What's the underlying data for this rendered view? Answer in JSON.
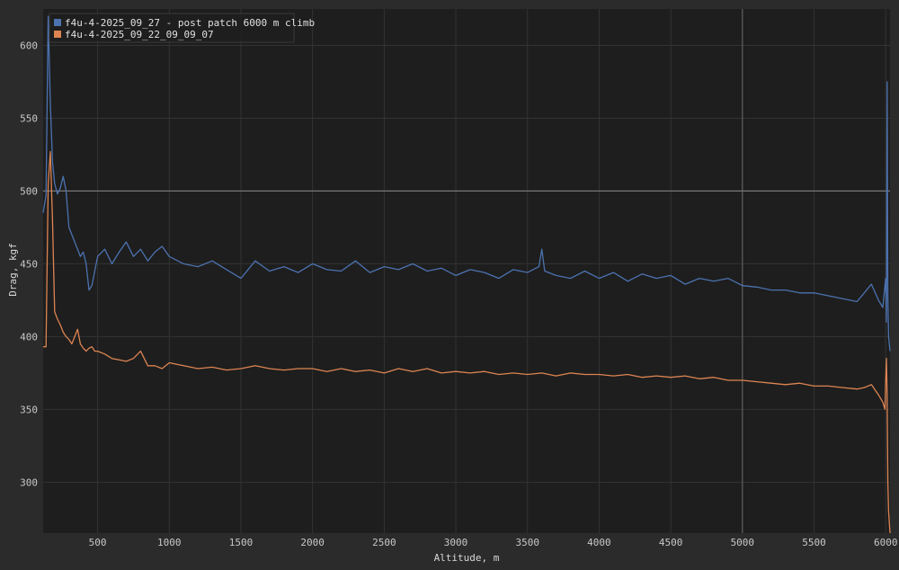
{
  "chart_data": {
    "type": "line",
    "xlabel": "Altitude, m",
    "ylabel": "Drag, kgf",
    "xlim": [
      120,
      6030
    ],
    "ylim": [
      265,
      625
    ],
    "xticks": [
      500,
      1000,
      1500,
      2000,
      2500,
      3000,
      3500,
      4000,
      4500,
      5000,
      5500,
      6000
    ],
    "yticks": [
      300,
      350,
      400,
      450,
      500,
      550,
      600
    ],
    "grid": true,
    "legend_position": "top-left",
    "reference_lines": {
      "horizontal_at_y": 500,
      "vertical_at_x": 5000
    },
    "series": [
      {
        "name": "f4u-4-2025_09_27 - post patch 6000 m climb",
        "color": "#4c72b0",
        "x": [
          120,
          140,
          155,
          170,
          185,
          200,
          220,
          240,
          260,
          280,
          300,
          320,
          340,
          360,
          380,
          400,
          420,
          440,
          460,
          480,
          500,
          550,
          600,
          650,
          700,
          750,
          800,
          850,
          900,
          950,
          1000,
          1100,
          1200,
          1300,
          1400,
          1500,
          1600,
          1700,
          1800,
          1900,
          2000,
          2100,
          2200,
          2300,
          2400,
          2500,
          2600,
          2700,
          2800,
          2900,
          3000,
          3100,
          3200,
          3300,
          3400,
          3500,
          3580,
          3600,
          3620,
          3700,
          3800,
          3900,
          4000,
          4100,
          4200,
          4300,
          4400,
          4500,
          4600,
          4700,
          4800,
          4900,
          5000,
          5100,
          5200,
          5300,
          5400,
          5500,
          5600,
          5700,
          5800,
          5850,
          5900,
          5950,
          5980,
          6000,
          6005,
          6010,
          6015,
          6020,
          6030
        ],
        "y": [
          485,
          497,
          620,
          560,
          520,
          505,
          498,
          502,
          510,
          500,
          475,
          470,
          465,
          460,
          455,
          458,
          450,
          432,
          435,
          445,
          455,
          460,
          450,
          458,
          465,
          455,
          460,
          452,
          458,
          462,
          455,
          450,
          448,
          452,
          446,
          440,
          452,
          445,
          448,
          444,
          450,
          446,
          445,
          452,
          444,
          448,
          446,
          450,
          445,
          447,
          442,
          446,
          444,
          440,
          446,
          444,
          448,
          460,
          445,
          442,
          440,
          445,
          440,
          444,
          438,
          443,
          440,
          442,
          436,
          440,
          438,
          440,
          435,
          434,
          432,
          432,
          430,
          430,
          428,
          426,
          424,
          430,
          436,
          425,
          420,
          440,
          410,
          575,
          430,
          400,
          390
        ]
      },
      {
        "name": "f4u-4-2025_09_22_09_09_07",
        "color": "#dd8452",
        "x": [
          120,
          140,
          155,
          170,
          185,
          200,
          220,
          240,
          260,
          280,
          300,
          320,
          340,
          360,
          380,
          400,
          420,
          440,
          460,
          480,
          500,
          550,
          600,
          650,
          700,
          750,
          800,
          850,
          900,
          950,
          1000,
          1100,
          1200,
          1300,
          1400,
          1500,
          1600,
          1700,
          1800,
          1900,
          2000,
          2100,
          2200,
          2300,
          2400,
          2500,
          2600,
          2700,
          2800,
          2900,
          3000,
          3100,
          3200,
          3300,
          3400,
          3500,
          3600,
          3700,
          3800,
          3900,
          4000,
          4100,
          4200,
          4300,
          4400,
          4500,
          4600,
          4700,
          4800,
          4900,
          5000,
          5100,
          5200,
          5300,
          5400,
          5500,
          5600,
          5700,
          5800,
          5850,
          5900,
          5950,
          5980,
          5995,
          6000,
          6005,
          6010,
          6015,
          6020,
          6030
        ],
        "y": [
          393,
          393,
          505,
          527,
          480,
          417,
          412,
          408,
          403,
          400,
          398,
          395,
          400,
          405,
          395,
          392,
          390,
          392,
          393,
          390,
          390,
          388,
          385,
          384,
          383,
          385,
          390,
          380,
          380,
          378,
          382,
          380,
          378,
          379,
          377,
          378,
          380,
          378,
          377,
          378,
          378,
          376,
          378,
          376,
          377,
          375,
          378,
          376,
          378,
          375,
          376,
          375,
          376,
          374,
          375,
          374,
          375,
          373,
          375,
          374,
          374,
          373,
          374,
          372,
          373,
          372,
          373,
          371,
          372,
          370,
          370,
          369,
          368,
          367,
          368,
          366,
          366,
          365,
          364,
          365,
          367,
          360,
          355,
          350,
          370,
          385,
          360,
          300,
          280,
          265
        ]
      }
    ]
  }
}
